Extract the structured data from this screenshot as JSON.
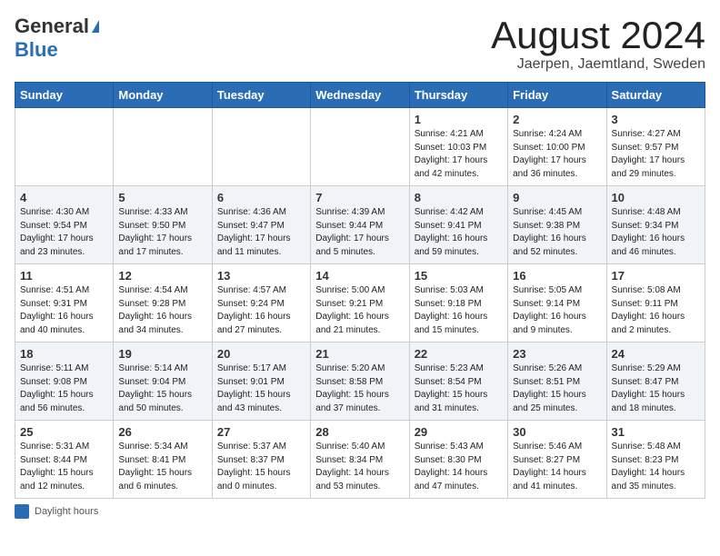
{
  "header": {
    "logo_general": "General",
    "logo_blue": "Blue",
    "month_title": "August 2024",
    "location": "Jaerpen, Jaemtland, Sweden"
  },
  "days_of_week": [
    "Sunday",
    "Monday",
    "Tuesday",
    "Wednesday",
    "Thursday",
    "Friday",
    "Saturday"
  ],
  "weeks": [
    [
      {
        "day": "",
        "sunrise": "",
        "sunset": "",
        "daylight": ""
      },
      {
        "day": "",
        "sunrise": "",
        "sunset": "",
        "daylight": ""
      },
      {
        "day": "",
        "sunrise": "",
        "sunset": "",
        "daylight": ""
      },
      {
        "day": "",
        "sunrise": "",
        "sunset": "",
        "daylight": ""
      },
      {
        "day": "1",
        "sunrise": "Sunrise: 4:21 AM",
        "sunset": "Sunset: 10:03 PM",
        "daylight": "Daylight: 17 hours and 42 minutes."
      },
      {
        "day": "2",
        "sunrise": "Sunrise: 4:24 AM",
        "sunset": "Sunset: 10:00 PM",
        "daylight": "Daylight: 17 hours and 36 minutes."
      },
      {
        "day": "3",
        "sunrise": "Sunrise: 4:27 AM",
        "sunset": "Sunset: 9:57 PM",
        "daylight": "Daylight: 17 hours and 29 minutes."
      }
    ],
    [
      {
        "day": "4",
        "sunrise": "Sunrise: 4:30 AM",
        "sunset": "Sunset: 9:54 PM",
        "daylight": "Daylight: 17 hours and 23 minutes."
      },
      {
        "day": "5",
        "sunrise": "Sunrise: 4:33 AM",
        "sunset": "Sunset: 9:50 PM",
        "daylight": "Daylight: 17 hours and 17 minutes."
      },
      {
        "day": "6",
        "sunrise": "Sunrise: 4:36 AM",
        "sunset": "Sunset: 9:47 PM",
        "daylight": "Daylight: 17 hours and 11 minutes."
      },
      {
        "day": "7",
        "sunrise": "Sunrise: 4:39 AM",
        "sunset": "Sunset: 9:44 PM",
        "daylight": "Daylight: 17 hours and 5 minutes."
      },
      {
        "day": "8",
        "sunrise": "Sunrise: 4:42 AM",
        "sunset": "Sunset: 9:41 PM",
        "daylight": "Daylight: 16 hours and 59 minutes."
      },
      {
        "day": "9",
        "sunrise": "Sunrise: 4:45 AM",
        "sunset": "Sunset: 9:38 PM",
        "daylight": "Daylight: 16 hours and 52 minutes."
      },
      {
        "day": "10",
        "sunrise": "Sunrise: 4:48 AM",
        "sunset": "Sunset: 9:34 PM",
        "daylight": "Daylight: 16 hours and 46 minutes."
      }
    ],
    [
      {
        "day": "11",
        "sunrise": "Sunrise: 4:51 AM",
        "sunset": "Sunset: 9:31 PM",
        "daylight": "Daylight: 16 hours and 40 minutes."
      },
      {
        "day": "12",
        "sunrise": "Sunrise: 4:54 AM",
        "sunset": "Sunset: 9:28 PM",
        "daylight": "Daylight: 16 hours and 34 minutes."
      },
      {
        "day": "13",
        "sunrise": "Sunrise: 4:57 AM",
        "sunset": "Sunset: 9:24 PM",
        "daylight": "Daylight: 16 hours and 27 minutes."
      },
      {
        "day": "14",
        "sunrise": "Sunrise: 5:00 AM",
        "sunset": "Sunset: 9:21 PM",
        "daylight": "Daylight: 16 hours and 21 minutes."
      },
      {
        "day": "15",
        "sunrise": "Sunrise: 5:03 AM",
        "sunset": "Sunset: 9:18 PM",
        "daylight": "Daylight: 16 hours and 15 minutes."
      },
      {
        "day": "16",
        "sunrise": "Sunrise: 5:05 AM",
        "sunset": "Sunset: 9:14 PM",
        "daylight": "Daylight: 16 hours and 9 minutes."
      },
      {
        "day": "17",
        "sunrise": "Sunrise: 5:08 AM",
        "sunset": "Sunset: 9:11 PM",
        "daylight": "Daylight: 16 hours and 2 minutes."
      }
    ],
    [
      {
        "day": "18",
        "sunrise": "Sunrise: 5:11 AM",
        "sunset": "Sunset: 9:08 PM",
        "daylight": "Daylight: 15 hours and 56 minutes."
      },
      {
        "day": "19",
        "sunrise": "Sunrise: 5:14 AM",
        "sunset": "Sunset: 9:04 PM",
        "daylight": "Daylight: 15 hours and 50 minutes."
      },
      {
        "day": "20",
        "sunrise": "Sunrise: 5:17 AM",
        "sunset": "Sunset: 9:01 PM",
        "daylight": "Daylight: 15 hours and 43 minutes."
      },
      {
        "day": "21",
        "sunrise": "Sunrise: 5:20 AM",
        "sunset": "Sunset: 8:58 PM",
        "daylight": "Daylight: 15 hours and 37 minutes."
      },
      {
        "day": "22",
        "sunrise": "Sunrise: 5:23 AM",
        "sunset": "Sunset: 8:54 PM",
        "daylight": "Daylight: 15 hours and 31 minutes."
      },
      {
        "day": "23",
        "sunrise": "Sunrise: 5:26 AM",
        "sunset": "Sunset: 8:51 PM",
        "daylight": "Daylight: 15 hours and 25 minutes."
      },
      {
        "day": "24",
        "sunrise": "Sunrise: 5:29 AM",
        "sunset": "Sunset: 8:47 PM",
        "daylight": "Daylight: 15 hours and 18 minutes."
      }
    ],
    [
      {
        "day": "25",
        "sunrise": "Sunrise: 5:31 AM",
        "sunset": "Sunset: 8:44 PM",
        "daylight": "Daylight: 15 hours and 12 minutes."
      },
      {
        "day": "26",
        "sunrise": "Sunrise: 5:34 AM",
        "sunset": "Sunset: 8:41 PM",
        "daylight": "Daylight: 15 hours and 6 minutes."
      },
      {
        "day": "27",
        "sunrise": "Sunrise: 5:37 AM",
        "sunset": "Sunset: 8:37 PM",
        "daylight": "Daylight: 15 hours and 0 minutes."
      },
      {
        "day": "28",
        "sunrise": "Sunrise: 5:40 AM",
        "sunset": "Sunset: 8:34 PM",
        "daylight": "Daylight: 14 hours and 53 minutes."
      },
      {
        "day": "29",
        "sunrise": "Sunrise: 5:43 AM",
        "sunset": "Sunset: 8:30 PM",
        "daylight": "Daylight: 14 hours and 47 minutes."
      },
      {
        "day": "30",
        "sunrise": "Sunrise: 5:46 AM",
        "sunset": "Sunset: 8:27 PM",
        "daylight": "Daylight: 14 hours and 41 minutes."
      },
      {
        "day": "31",
        "sunrise": "Sunrise: 5:48 AM",
        "sunset": "Sunset: 8:23 PM",
        "daylight": "Daylight: 14 hours and 35 minutes."
      }
    ]
  ],
  "footer": {
    "label": "Daylight hours"
  }
}
